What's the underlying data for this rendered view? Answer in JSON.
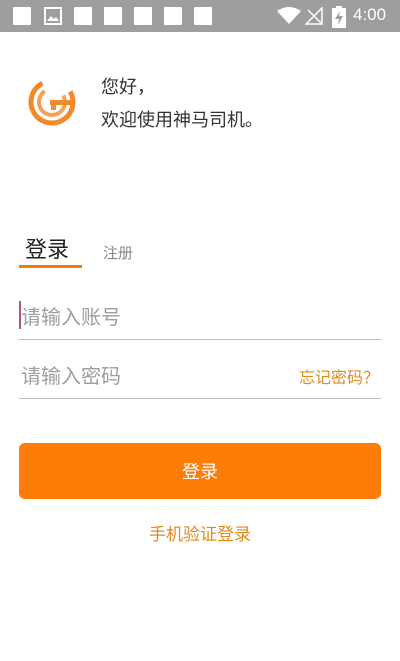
{
  "status_bar": {
    "time": "4:00",
    "icons": [
      "notification-icon",
      "image-icon",
      "notification-icon",
      "notification-icon",
      "notification-icon",
      "notification-icon",
      "wifi-icon",
      "no-signal-icon",
      "battery-charging-icon"
    ]
  },
  "header": {
    "greeting_line1": "您好，",
    "greeting_line2": "欢迎使用神马司机。",
    "logo_icon": "brand-g-logo"
  },
  "tabs": {
    "login": "登录",
    "register": "注册",
    "active": "login"
  },
  "form": {
    "account_placeholder": "请输入账号",
    "account_value": "",
    "password_placeholder": "请输入密码",
    "password_value": "",
    "forgot_label": "忘记密码？"
  },
  "actions": {
    "login_button": "登录",
    "sms_login_link": "手机验证登录"
  },
  "colors": {
    "accent": "#ff7c08",
    "link": "#e08a1e",
    "status_bar": "#9e9e9e"
  }
}
